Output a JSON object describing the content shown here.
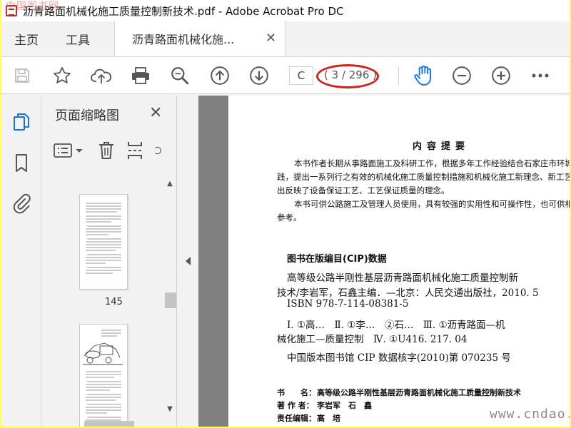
{
  "window": {
    "title": "沥青路面机械化施工质量控制新技术.pdf - Adobe Acrobat Pro DC",
    "watermark_top": "中国图书网",
    "watermark_bottom": "www.cndao.com"
  },
  "tabs": {
    "home": "主页",
    "tools": "工具",
    "document": "沥青路面机械化施...",
    "close": "✕"
  },
  "toolbar": {
    "page_input": "C",
    "page_count": "( 3 / 296 )",
    "icons": [
      "save-icon",
      "bookmark-star-icon",
      "upload-cloud-icon",
      "print-icon",
      "zoom-search-icon",
      "page-up-icon",
      "page-down-icon",
      "hand-tool-icon",
      "zoom-out-icon",
      "zoom-in-icon",
      "more-icon"
    ],
    "highlight_color": "#d62020",
    "accent": "#1473e6"
  },
  "rail": {
    "icons": [
      "page-thumbnails-icon",
      "bookmarks-icon",
      "attachments-icon"
    ]
  },
  "thumb_panel": {
    "title": "页面缩略图",
    "close": "✕",
    "thumbnails": [
      {
        "label": "145"
      },
      {
        "label": ""
      }
    ]
  },
  "document": {
    "section_title": "内容提要",
    "intro_lines": [
      "本书作者长期从事路面施工及科研工作，根据多年工作经验结合石家庄市环城",
      "践，提出一系列行之有效的机械化施工质量控制措施和机械化施工新理念、新工艺和",
      "出反映了设备保证工艺、工艺保证质量的理念。",
      "本书可供公路施工及管理人员使用，具有较强的实用性和可操作性，也可供相",
      "参考。"
    ],
    "cip_title": "图书在版编目(CIP)数据",
    "cip_lines": [
      "高等级公路半刚性基层沥青路面机械化施工质量控制新",
      "技术/李岩军，石鑫主编．—北京：人民交通出版社，2010. 5",
      "ISBN 978-7-114-08381-5",
      "Ⅰ. ①高…　Ⅱ. ①李…　②石…　Ⅲ. ①沥青路面—机",
      "械化施工—质量控制　Ⅳ. ①U416. 217. 04",
      "中国版本图书馆 CIP 数据核字(2010)第 070235 号"
    ],
    "meta": {
      "book_label": "书　　名：",
      "book_value": "高等级公路半刚性基层沥青路面机械化施工质量控制新技术",
      "author_label": "著 作 者：",
      "author_value": "李岩军　石　鑫",
      "editor_label": "责任编辑：",
      "editor_value": "高　培"
    }
  }
}
